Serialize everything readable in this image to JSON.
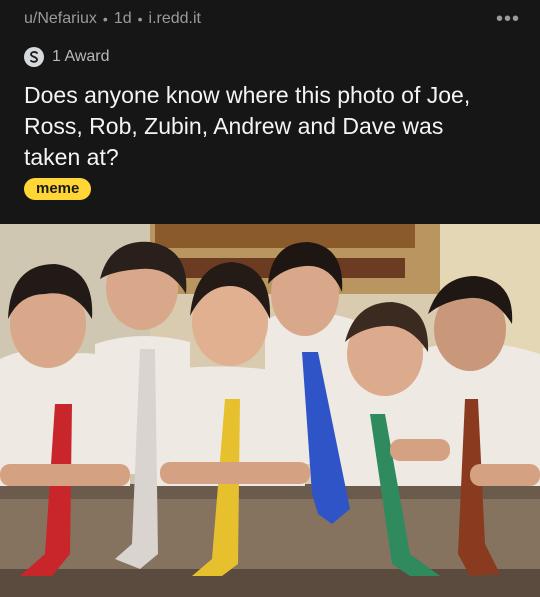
{
  "post": {
    "user": "u/Nefariux",
    "age": "1d",
    "domain": "i.redd.it",
    "award_text": "1 Award",
    "title": "Does anyone know where this photo of Joe, Ross, Rob, Zubin, Andrew and Dave was taken at?",
    "flair": "meme"
  },
  "colors": {
    "background": "#161617",
    "flair_bg": "#ffd635",
    "tie_colors": [
      "#c8262a",
      "#d9d4d0",
      "#e7c02d",
      "#2f54c7",
      "#2f8b5e",
      "#8a3a1e"
    ]
  },
  "icons": {
    "more": "more-options-icon",
    "award": "award-icon"
  }
}
